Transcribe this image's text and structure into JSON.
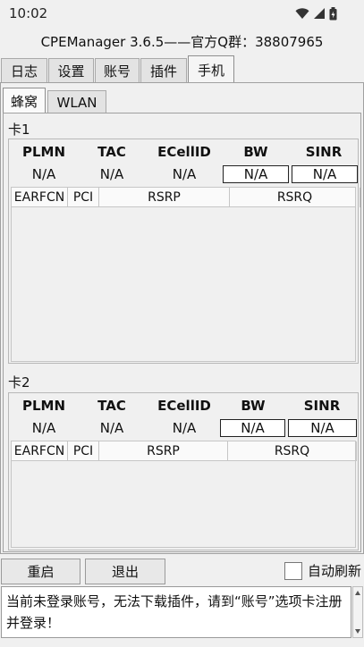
{
  "status_bar": {
    "time": "10:02"
  },
  "app": {
    "title": "CPEManager 3.6.5——官方Q群：38807965"
  },
  "main_tabs": [
    "日志",
    "设置",
    "账号",
    "插件",
    "手机"
  ],
  "sub_tabs": [
    "蜂窝",
    "WLAN"
  ],
  "cards": [
    {
      "label": "卡1",
      "headers": [
        "PLMN",
        "TAC",
        "ECellID",
        "BW",
        "SINR"
      ],
      "values": [
        "N/A",
        "N/A",
        "N/A",
        "N/A",
        "N/A"
      ],
      "table_columns": [
        "EARFCN",
        "PCI",
        "RSRP",
        "RSRQ"
      ]
    },
    {
      "label": "卡2",
      "headers": [
        "PLMN",
        "TAC",
        "ECellID",
        "BW",
        "SINR"
      ],
      "values": [
        "N/A",
        "N/A",
        "N/A",
        "N/A",
        "N/A"
      ],
      "table_columns": [
        "EARFCN",
        "PCI",
        "RSRP",
        "RSRQ"
      ]
    }
  ],
  "buttons": {
    "restart": "重启",
    "exit": "退出"
  },
  "auto_refresh": {
    "label": "自动刷新",
    "checked": false
  },
  "message": "当前未登录账号，无法下载插件，请到“账号”选项卡注册并登录！",
  "icons": [
    "wifi-icon",
    "signal-icon",
    "battery-icon"
  ]
}
